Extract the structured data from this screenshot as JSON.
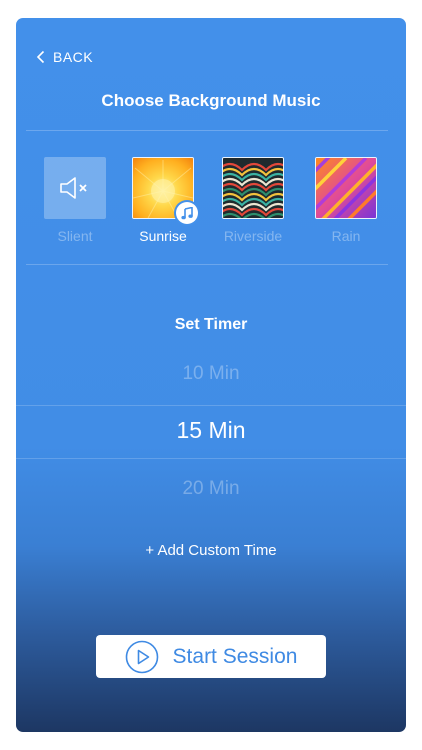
{
  "header": {
    "back_label": "BACK",
    "title": "Choose Background Music"
  },
  "tracks": [
    {
      "label": "Slient",
      "icon": "speaker-muted-icon",
      "selected": false
    },
    {
      "label": "Sunrise",
      "icon": "sunrise-artwork",
      "selected": true
    },
    {
      "label": "Riverside",
      "icon": "riverside-artwork",
      "selected": false
    },
    {
      "label": "Rain",
      "icon": "rain-artwork",
      "selected": false
    }
  ],
  "timer": {
    "title": "Set Timer",
    "options": [
      "10  Min",
      "15 Min",
      "20 Min"
    ],
    "selected_index": 1,
    "add_custom_label": "+ Add Custom Time"
  },
  "actions": {
    "start_label": "Start Session"
  },
  "colors": {
    "accent": "#4390ea",
    "button_text": "#3f8ae3",
    "background_bottom": "#1d3763"
  }
}
